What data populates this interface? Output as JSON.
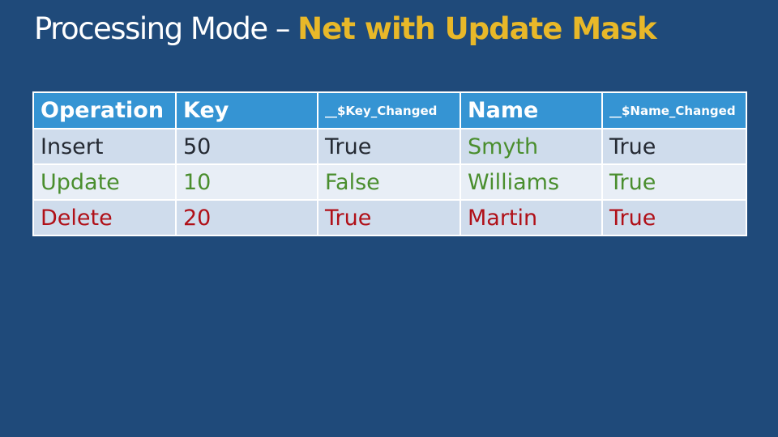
{
  "slide": {
    "title_prefix": "Processing Mode – ",
    "title_accent": "Net with Update Mask",
    "colors": {
      "background": "#1f4a7a",
      "accent": "#e8b829",
      "header": "#3594d3",
      "insert_text": "#252a33",
      "update_text": "#4a8e2e",
      "delete_text": "#b01018"
    }
  },
  "table": {
    "headers": [
      "Operation",
      "Key",
      "__$Key_Changed",
      "Name",
      "__$Name_Changed"
    ],
    "rows": [
      {
        "operation": "Insert",
        "key": "50",
        "key_changed": "True",
        "name": "Smyth",
        "name_changed": "True"
      },
      {
        "operation": "Update",
        "key": "10",
        "key_changed": "False",
        "name": "Williams",
        "name_changed": "True"
      },
      {
        "operation": "Delete",
        "key": "20",
        "key_changed": "True",
        "name": "Martin",
        "name_changed": "True"
      }
    ]
  }
}
